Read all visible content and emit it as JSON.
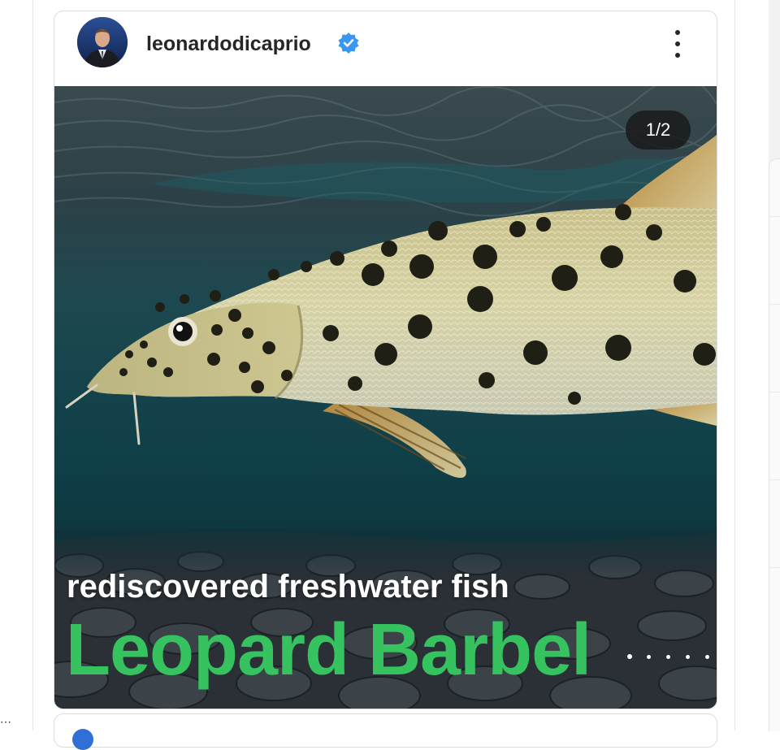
{
  "post": {
    "username": "leonardodicaprio",
    "verified": true,
    "avatar_icon": "profile-photo-avatar",
    "more_icon": "more-vertical-icon"
  },
  "media": {
    "counter": "1/2",
    "current_slide": 1,
    "total_slides": 2,
    "subtitle": "rediscovered freshwater fish",
    "title": "Leopard Barbel",
    "accent_color": "#35c25f",
    "image_description_icon": "leopard-barbel-fish-photo"
  },
  "colors": {
    "verified_badge": "#3897f0",
    "text_primary": "#262626"
  }
}
